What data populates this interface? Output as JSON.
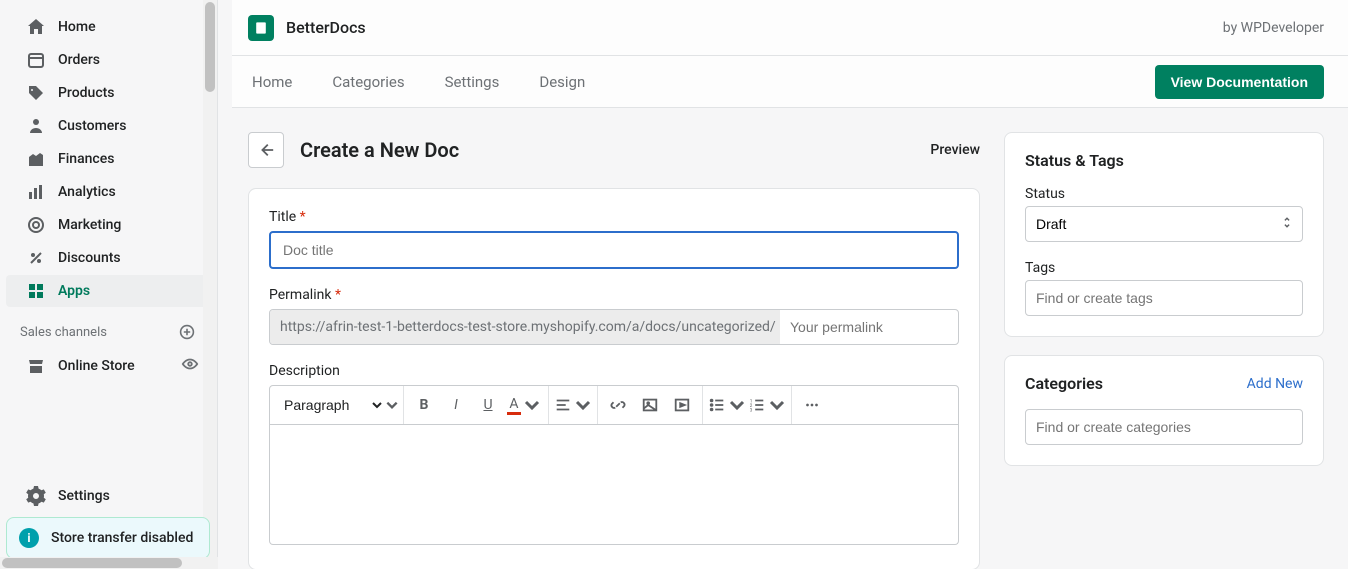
{
  "sidebar": {
    "items": [
      {
        "label": "Home"
      },
      {
        "label": "Orders"
      },
      {
        "label": "Products"
      },
      {
        "label": "Customers"
      },
      {
        "label": "Finances"
      },
      {
        "label": "Analytics"
      },
      {
        "label": "Marketing"
      },
      {
        "label": "Discounts"
      },
      {
        "label": "Apps"
      }
    ],
    "sales_channels_label": "Sales channels",
    "online_store_label": "Online Store",
    "settings_label": "Settings",
    "banner_text": "Store transfer disabled"
  },
  "topbar": {
    "app_title": "BetterDocs",
    "by_text": "by WPDeveloper"
  },
  "tabs": {
    "items": [
      {
        "label": "Home"
      },
      {
        "label": "Categories"
      },
      {
        "label": "Settings"
      },
      {
        "label": "Design"
      }
    ],
    "view_doc_label": "View Documentation"
  },
  "page": {
    "title": "Create a New Doc",
    "preview_label": "Preview"
  },
  "form": {
    "title_label": "Title",
    "title_placeholder": "Doc title",
    "permalink_label": "Permalink",
    "permalink_base": "https://afrin-test-1-betterdocs-test-store.myshopify.com/a/docs/uncategorized/",
    "permalink_slug_placeholder": "Your permalink",
    "description_label": "Description",
    "block_format": "Paragraph"
  },
  "status_card": {
    "heading": "Status & Tags",
    "status_label": "Status",
    "status_value": "Draft",
    "tags_label": "Tags",
    "tags_placeholder": "Find or create tags"
  },
  "categories_card": {
    "heading": "Categories",
    "add_new_label": "Add New",
    "placeholder": "Find or create categories"
  }
}
